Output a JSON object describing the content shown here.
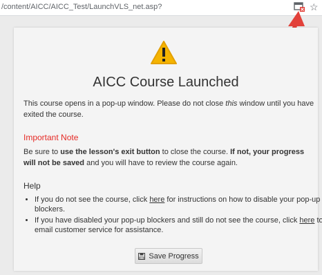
{
  "browser": {
    "url": "/content/AICC/AICC_Test/LaunchVLS_net.asp?",
    "icons": {
      "popup_blocked": "popup-blocked-icon",
      "bookmark": "star-icon"
    },
    "star_glyph": "☆"
  },
  "page": {
    "warning_icon": "warning-icon",
    "title": "AICC Course Launched",
    "intro": {
      "part1": "This course opens in a pop-up window. Please do not close ",
      "emph": "this",
      "part2": " window until you have exited the course."
    },
    "important_note": {
      "heading": "Important Note",
      "t1": "Be sure to ",
      "b1": "use the lesson's exit button",
      "t2": " to close the course. ",
      "b2": "If not, your progress will not be saved",
      "t3": " and you will have to review the course again."
    },
    "help": {
      "heading": "Help",
      "items": [
        {
          "before": "If you do not see the course, click ",
          "link": "here",
          "after": " for instructions on how to disable your pop-up blockers."
        },
        {
          "before": "If you have disabled your pop-up blockers and still do not see the course, click ",
          "link": "here",
          "after": " to email customer service for assistance."
        }
      ]
    },
    "save_button": {
      "label": "Save Progress",
      "icon": "save-icon"
    }
  },
  "colors": {
    "note": "#e52a25",
    "warning": "#f5b400",
    "arrow": "#e2413a"
  }
}
